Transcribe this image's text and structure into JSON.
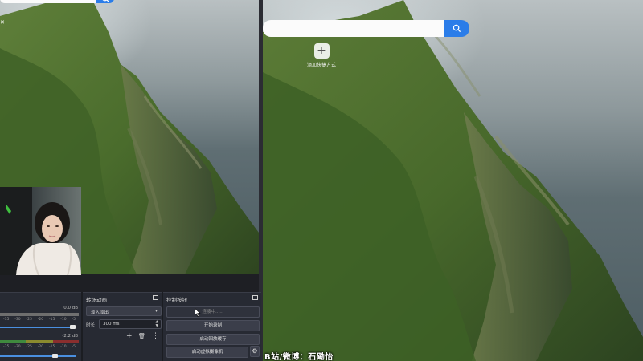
{
  "browser": {
    "right_search": {
      "value": "",
      "placeholder": ""
    },
    "left_search": {
      "value": "",
      "placeholder": ""
    },
    "shortcut": {
      "icon": "plus-icon",
      "glyph": "+",
      "label": "添加快捷方式"
    },
    "close_glyph": "✕"
  },
  "obs": {
    "mixer": {
      "title": "",
      "channels": [
        {
          "db": "0.0 dB",
          "scale": [
            "-35",
            "-30",
            "-25",
            "-20",
            "-15",
            "-10",
            "-5"
          ],
          "volume": 0.95
        },
        {
          "db": "-2.2 dB",
          "scale": [
            "-35",
            "-30",
            "-25",
            "-20",
            "-15",
            "-10",
            "-5"
          ],
          "volume": 0.72
        }
      ]
    },
    "transition": {
      "title": "转场动画",
      "selected": "淡入淡出",
      "duration_label": "时长",
      "duration_value": "300 ms",
      "add_glyph": "+",
      "delete_glyph": "🗑",
      "more_glyph": "⋮"
    },
    "controls": {
      "title": "控制按钮",
      "connecting": "连接中......",
      "start_recording": "开始录制",
      "start_replay_buffer": "启动回放缓存",
      "start_virtual_camera": "启动虚拟摄像机",
      "gear_glyph": "⚙"
    },
    "float_glyph": ""
  },
  "watermark": "B站/微博：石磡怡",
  "colors": {
    "search_button": "#2b7de9",
    "dock_bg": "#272a33",
    "meter_green": "#3f8a3e",
    "meter_yellow": "#8a8a2e",
    "meter_red": "#8a2e2e"
  }
}
